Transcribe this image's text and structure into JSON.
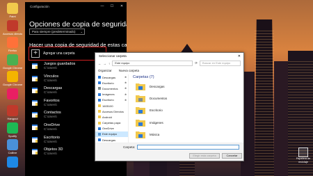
{
  "desktop": {
    "icons": [
      {
        "label": "Paint",
        "color": "#f2c94c"
      },
      {
        "label": "Accesos directos",
        "color": "#c0392b"
      },
      {
        "label": "Firefox",
        "color": "#ff7139"
      },
      {
        "label": "Google Chrome",
        "color": "#4caf50"
      },
      {
        "label": "Google Chrome Canary",
        "color": "#f4b400"
      },
      {
        "label": "",
        "color": "#e91e63"
      },
      {
        "label": "Hangout",
        "color": "#c0392b"
      },
      {
        "label": "Spotify",
        "color": "#1db954"
      },
      {
        "label": "Calibre",
        "color": "#4a90d9"
      },
      {
        "label": "",
        "color": "#1e88e5"
      }
    ],
    "corner_icon_label": "Papelera de reciclaje"
  },
  "settings": {
    "title": "Configuración",
    "heading": "Opciones de copia de seguridad",
    "dropdown_value": "Para siempre (predeterminado)",
    "section_heading": "Hacer una copia de seguridad de estas carpetas",
    "add_folder_label": "Agregar una carpeta",
    "accent": "#d02020",
    "folders": [
      {
        "name": "Juegos guardados",
        "path": "C:\\Users\\"
      },
      {
        "name": "Vínculos",
        "path": "C:\\Users\\"
      },
      {
        "name": "Descargas",
        "path": "C:\\Users\\"
      },
      {
        "name": "Favoritos",
        "path": "C:\\Users\\"
      },
      {
        "name": "Contactos",
        "path": "C:\\Users\\"
      },
      {
        "name": "OneDrive",
        "path": "C:\\Users\\"
      },
      {
        "name": "Escritorio",
        "path": "C:\\Users\\"
      },
      {
        "name": "Objetos 3D",
        "path": "C:\\Users\\"
      }
    ]
  },
  "dialog": {
    "title": "Seleccionar carpeta",
    "address": "Este equipo",
    "search_placeholder": "Buscar en Este equipo",
    "organize": "Organizar",
    "new_folder": "Nueva carpeta",
    "sidebar": [
      {
        "label": "Descargas",
        "pinned": true,
        "color": "#2b79d8"
      },
      {
        "label": "Escritorio",
        "pinned": true,
        "color": "#2b79d8"
      },
      {
        "label": "Documentos",
        "pinned": true,
        "color": "#7f8c8d"
      },
      {
        "label": "Imágenes",
        "pinned": true,
        "color": "#2b79d8"
      },
      {
        "label": "Escritorio",
        "pinned": true,
        "color": "#2b79d8"
      },
      {
        "label": "1605100",
        "pinned": false,
        "color": "#f2c94c"
      },
      {
        "label": "Accesos Directos",
        "pinned": false,
        "color": "#f2c94c"
      },
      {
        "label": "Android",
        "pinned": false,
        "color": "#f2c94c"
      },
      {
        "label": "Carpetas papá",
        "pinned": false,
        "color": "#f2c94c"
      },
      {
        "label": "OneDrive",
        "pinned": false,
        "color": "#2b79d8"
      },
      {
        "label": "Este equipo",
        "pinned": false,
        "color": "#5b9bd5",
        "selected": true
      },
      {
        "label": "Descargas",
        "pinned": false,
        "color": "#2b79d8"
      },
      {
        "label": "Documentos",
        "pinned": false,
        "color": "#7f8c8d"
      }
    ],
    "section_label": "Carpetas (7)",
    "folders": [
      {
        "label": "Descargas",
        "color": "#2b79d8"
      },
      {
        "label": "Documentos",
        "color": "#7f8c8d"
      },
      {
        "label": "Escritorio",
        "color": "#2b79d8"
      },
      {
        "label": "Imágenes",
        "color": "#2b79d8"
      },
      {
        "label": "Música",
        "color": "#2b79d8"
      }
    ],
    "folder_field_label": "Carpeta:",
    "select_button": "Elegir esta carpeta",
    "cancel_button": "Cancelar"
  }
}
